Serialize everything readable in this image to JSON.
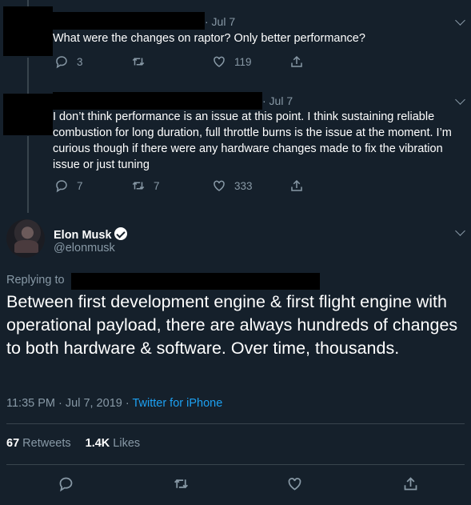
{
  "reply1": {
    "time": "· Jul 7",
    "text": "What were the changes on raptor? Only better performance?",
    "replies": "3",
    "retweets": "",
    "likes": "119"
  },
  "reply2": {
    "time": "· Jul 7",
    "text": "I don’t think performance is an issue at this point. I think sustaining reliable combustion for long duration, full throttle burns is the issue at the moment. I’m curious though if there were any hardware changes made to fix the vibration issue or just tuning",
    "replies": "7",
    "retweets": "7",
    "likes": "333"
  },
  "main": {
    "name": "Elon Musk",
    "handle": "@elonmusk",
    "replying_to": "Replying to",
    "text": "Between first development engine & first flight engine with operational payload, there are always hundreds of changes to both hardware & software. Over time, thousands.",
    "timestamp": "11:35 PM · Jul 7, 2019 · ",
    "source": "Twitter for iPhone",
    "retweet_count": "67",
    "retweet_label": "Retweets",
    "like_count": "1.4K",
    "like_label": "Likes"
  },
  "icons": {
    "reply": "reply-icon",
    "retweet": "retweet-icon",
    "like": "like-icon",
    "share": "share-icon",
    "chevron": "chevron-down-icon",
    "verified": "verified-badge-icon"
  },
  "colors": {
    "background": "#15202b",
    "muted": "#8899a6",
    "link": "#1da1f2",
    "divider": "#38444d"
  }
}
